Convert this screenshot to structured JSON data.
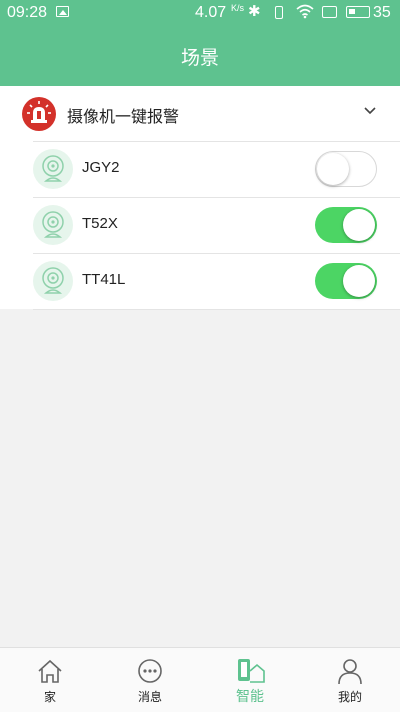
{
  "status_bar": {
    "time": "09:28",
    "speed": "4.07",
    "speed_unit": "K/s",
    "battery": "35"
  },
  "header": {
    "title": "场景"
  },
  "scene": {
    "name": "摄像机一键报警",
    "devices": [
      {
        "name": "JGY2",
        "enabled": false
      },
      {
        "name": "T52X",
        "enabled": true
      },
      {
        "name": "TT41L",
        "enabled": true
      }
    ]
  },
  "nav": {
    "items": [
      {
        "label": "家",
        "icon": "home-icon"
      },
      {
        "label": "消息",
        "icon": "message-icon"
      },
      {
        "label": "智能",
        "icon": "smart-icon",
        "active": true
      },
      {
        "label": "我的",
        "icon": "profile-icon"
      }
    ]
  },
  "colors": {
    "accent": "#5ec28f",
    "toggle_on": "#4cd564",
    "alarm": "#d3312a"
  }
}
